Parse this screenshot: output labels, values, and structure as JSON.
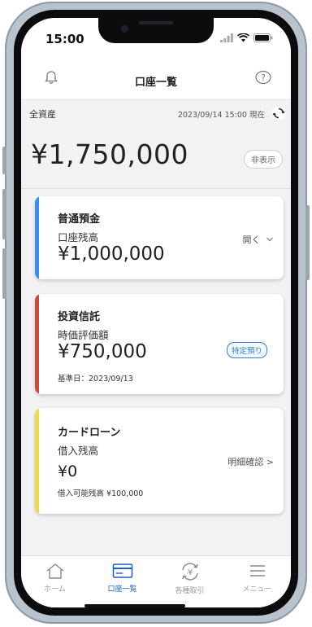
{
  "status_bar": {
    "time": "15:00"
  },
  "header": {
    "title": "口座一覧"
  },
  "assets": {
    "label": "全資産",
    "as_of": "2023/09/14 15:00 現在",
    "total": "¥1,750,000",
    "hide_label": "非表示"
  },
  "cards": [
    {
      "name": "普通預金",
      "sub_label": "口座残高",
      "amount": "¥1,000,000",
      "action": "開く",
      "accent": "#3d8bef"
    },
    {
      "name": "投資信託",
      "sub_label": "時価評価額",
      "amount": "¥750,000",
      "tag": "特定預り",
      "note": "基準日：2023/09/13",
      "accent": "#cc4a3c"
    },
    {
      "name": "カードローン",
      "sub_label": "借入残高",
      "amount": "¥0",
      "note": "借入可能残高 ¥100,000",
      "action": "明細確認 >",
      "accent": "#ecd94c"
    }
  ],
  "tabbar": {
    "items": [
      {
        "label": "ホーム",
        "icon": "home-icon"
      },
      {
        "label": "口座一覧",
        "icon": "card-icon"
      },
      {
        "label": "各種取引",
        "icon": "yen-exchange-icon"
      },
      {
        "label": "メニュー",
        "icon": "menu-icon"
      }
    ],
    "active_color": "#1c5fc8",
    "inactive_color": "#999999"
  }
}
